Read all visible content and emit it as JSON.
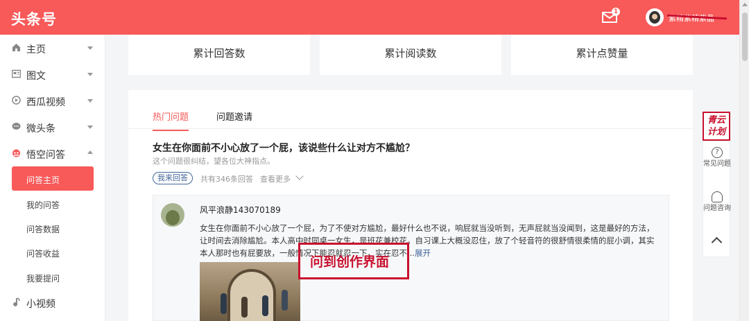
{
  "header": {
    "logo": "头条号",
    "mail_badge": "1",
    "username": "紫精紫精紫晶"
  },
  "sidebar": {
    "items": [
      {
        "label": "主页",
        "icon": "home-icon",
        "expanded": false
      },
      {
        "label": "图文",
        "icon": "article-icon",
        "expanded": false
      },
      {
        "label": "西瓜视频",
        "icon": "play-icon",
        "expanded": false
      },
      {
        "label": "微头条",
        "icon": "chat-icon",
        "expanded": false
      },
      {
        "label": "悟空问答",
        "icon": "wukong-icon",
        "expanded": true
      }
    ],
    "sub_items": [
      "问答主页",
      "我的问答",
      "问答数据",
      "问答收益",
      "我要提问"
    ],
    "bottom_item": {
      "label": "小视频",
      "icon": "music-note-icon"
    }
  },
  "stats": [
    "累计回答数",
    "累计阅读数",
    "累计点赞量"
  ],
  "tabs": {
    "hot": "热门问题",
    "invite": "问题邀请"
  },
  "question": {
    "title": "女生在你面前不小心放了一个屁，该说些什么让对方不尴尬？",
    "subtitle": "这个问题很纠结，望各位大神指点。",
    "answer_button": "我来回答",
    "answer_count": "共有346条回答",
    "view_more": "查看更多"
  },
  "answer": {
    "author": "风平浪静143070189",
    "text": "女生在你面前不小心放了一个屁，为了不使对方尴尬，最好什么也不说，响屁就当没听到，无声屁就当没闻到，这是最好的方法，让时间去消除尴尬。本人高中时同桌一女生，是班花兼校花。自习课上大概没忍住，放了个轻音符的很舒情很柔情的屁小调，其实本人那时也有屁要放，一般情况下能忍就忍一下，实在忍不...",
    "expand": "展开"
  },
  "annotation": "问到创作界面",
  "float_bar": {
    "badge": "青云计划",
    "faq": "常见问题",
    "consult": "问题咨询"
  },
  "colors": {
    "brand": "#f85959",
    "link": "#406599",
    "annotation": "#c8102e"
  }
}
